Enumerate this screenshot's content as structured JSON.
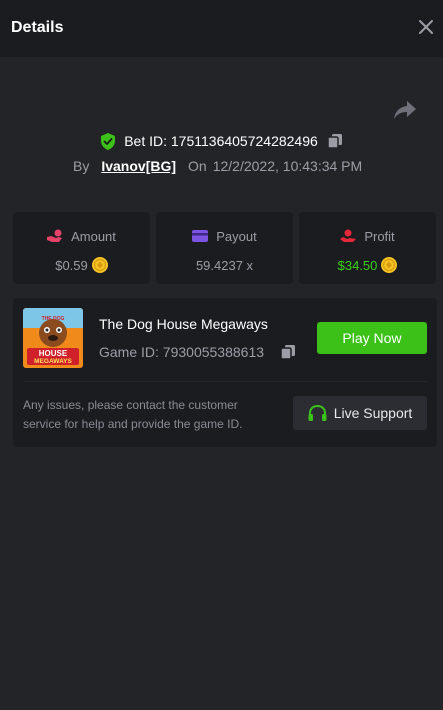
{
  "header": {
    "title": "Details"
  },
  "bet": {
    "id_label": "Bet ID: 1751136405724282496",
    "by_label": "By",
    "user": "Ivanov[BG]",
    "on_label": "On",
    "datetime": "12/2/2022, 10:43:34 PM"
  },
  "stats": {
    "amount": {
      "label": "Amount",
      "value": "$0.59"
    },
    "payout": {
      "label": "Payout",
      "value": "59.4237 x"
    },
    "profit": {
      "label": "Profit",
      "value": "$34.50"
    }
  },
  "game": {
    "thumb_text": {
      "line1": "THE DOG",
      "line2": "HOUSE",
      "line3": "MEGAWAYS"
    },
    "name": "The Dog House Megaways",
    "id_label": "Game ID: 7930055388613",
    "play_label": "Play Now"
  },
  "support": {
    "text": "Any issues, please contact the customer service for help and provide the game ID.",
    "button_label": "Live Support"
  },
  "icons": {
    "close": "close-icon",
    "share": "share-icon",
    "shield": "shield-check-icon",
    "copy": "copy-icon",
    "amount": "hand-coin-icon",
    "payout": "wallet-card-icon",
    "profit": "hand-profit-icon",
    "coin": "coin-icon",
    "support": "headset-icon"
  },
  "colors": {
    "accent_green": "#3bc117",
    "profit_green": "#38d315",
    "amount_icon": "#e5426a",
    "payout_icon": "#7b54e4",
    "profit_icon": "#e5283a",
    "shield_green": "#3bc117",
    "coin_gold": "#f5c423"
  }
}
